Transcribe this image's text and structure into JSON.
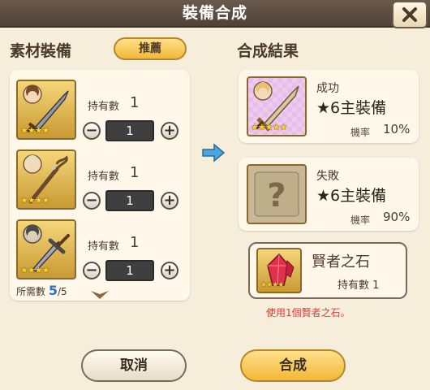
{
  "window": {
    "title": "裝備合成"
  },
  "left": {
    "heading": "素材裝備",
    "recommend_label": "推薦",
    "materials": [
      {
        "owned_label": "持有數",
        "owned": "1",
        "qty": "1",
        "stars": "★★★★"
      },
      {
        "owned_label": "持有數",
        "owned": "1",
        "qty": "1",
        "stars": "★★★★"
      },
      {
        "owned_label": "持有數",
        "owned": "1",
        "qty": "1",
        "stars": "★★★★"
      }
    ],
    "required_label": "所需數",
    "required_current": "5",
    "required_total": "/5"
  },
  "right": {
    "heading": "合成結果",
    "success": {
      "label": "成功",
      "name": "★6主裝備",
      "rate_label": "機率",
      "rate": "10%",
      "stars": "★★★★★"
    },
    "failure": {
      "label": "失敗",
      "name": "★6主裝備",
      "rate_label": "機率",
      "rate": "90%"
    },
    "stone": {
      "name": "賢者之石",
      "owned_label": "持有數",
      "owned": "1",
      "stars": "★★★★"
    },
    "note": "使用1個賢者之石。"
  },
  "buttons": {
    "cancel": "取消",
    "confirm": "合成"
  },
  "colors": {
    "accent": "#f2b836",
    "header": "#5a4c40",
    "warning": "#e03a3a",
    "count": "#2a6fd0"
  }
}
